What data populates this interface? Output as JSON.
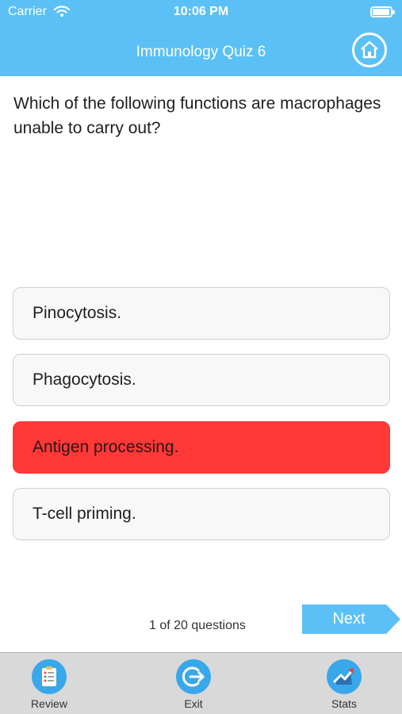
{
  "status_bar": {
    "carrier": "Carrier",
    "time": "10:06 PM",
    "battery_level": 0.95
  },
  "header": {
    "title": "Immunology Quiz 6"
  },
  "question": {
    "text": "Which of the following functions are macrophages unable to carry out?"
  },
  "answers": [
    {
      "label": "Pinocytosis.",
      "state": "neutral"
    },
    {
      "label": "Phagocytosis.",
      "state": "neutral"
    },
    {
      "label": "Antigen processing.",
      "state": "wrong"
    },
    {
      "label": "T-cell priming.",
      "state": "neutral"
    }
  ],
  "footer": {
    "progress": "1 of 20 questions",
    "next_label": "Next"
  },
  "tabs": [
    {
      "label": "Review",
      "icon": "review-icon"
    },
    {
      "label": "Exit",
      "icon": "exit-icon"
    },
    {
      "label": "Stats",
      "icon": "stats-icon"
    }
  ],
  "colors": {
    "accent": "#5bc0f5",
    "tab_icon": "#38a8ea",
    "wrong_answer": "#ff3838"
  }
}
